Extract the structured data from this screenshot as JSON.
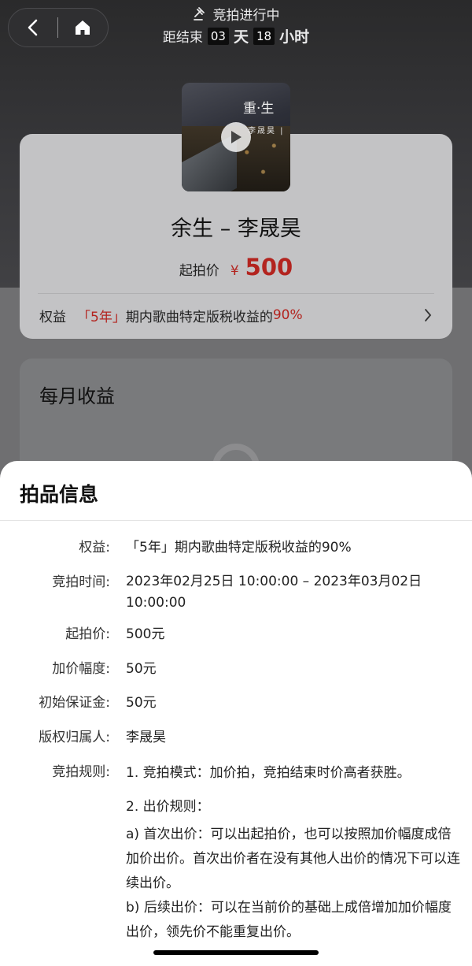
{
  "header": {
    "status_text": "竞拍进行中",
    "timer_prefix": "距结束",
    "days": "03",
    "days_unit": "天",
    "hours": "18",
    "hours_unit": "小时"
  },
  "cover": {
    "title": "重·生",
    "artist": "李晟昊 |"
  },
  "item": {
    "title": "余生 – 李晟昊",
    "price_label": "起拍价",
    "currency": "¥",
    "price": "500",
    "rights_label": "权益",
    "rights_years": "「5年」",
    "rights_text": "期内歌曲特定版税收益的",
    "rights_percent": "90%"
  },
  "monthly": {
    "title": "每月收益"
  },
  "sheet": {
    "title": "拍品信息",
    "rows": [
      {
        "key": "权益:",
        "value": "「5年」期内歌曲特定版税收益的90%"
      },
      {
        "key": "竞拍时间:",
        "value": "2023年02月25日 10:00:00 – 2023年03月02日 10:00:00"
      },
      {
        "key": "起拍价:",
        "value": "500元"
      },
      {
        "key": "加价幅度:",
        "value": "50元"
      },
      {
        "key": "初始保证金:",
        "value": "50元"
      },
      {
        "key": "版权归属人:",
        "value": "李晟昊"
      }
    ],
    "rules_key": "竞拍规则:",
    "rules": [
      "1. 竞拍模式：加价拍，竞拍结束时价高者获胜。",
      "2. 出价规则：",
      "a) 首次出价：可以出起拍价，也可以按照加价幅度成倍加价出价。首次出价者在没有其他人出价的情况下可以连续出价。",
      "b) 后续出价：可以在当前价的基础上成倍增加加价幅度出价，领先价不能重复出价。"
    ]
  },
  "colors": {
    "accent_red": "#b3241f"
  },
  "icons": {
    "back": "back-arrow-icon",
    "home": "home-icon",
    "auction": "gavel-icon",
    "play": "play-icon",
    "chevron": "chevron-right-icon"
  }
}
